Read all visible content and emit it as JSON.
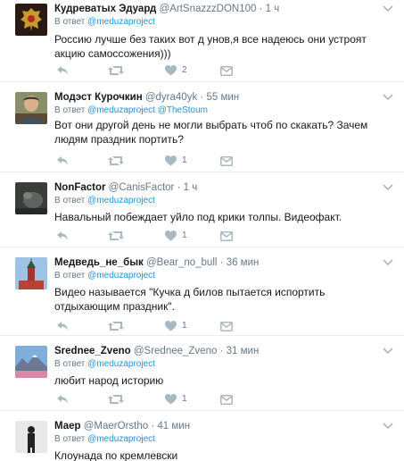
{
  "tweets": [
    {
      "name": "Кудреватых Эдуард",
      "handle": "@ArtSnazzzDON100",
      "separator": "·",
      "time": "1 ч",
      "reply_prefix": "В ответ",
      "mentions": [
        "@meduzaproject"
      ],
      "text": "Россию лучше без таких вот д  унов,я все надеюсь они устроят акцию самоссожения)))",
      "like_count": "2",
      "avatar_icon": "avatar-emblem"
    },
    {
      "name": "Модэст Курочкин",
      "handle": "@dyra40yk",
      "separator": "·",
      "time": "55 мин",
      "reply_prefix": "В ответ",
      "mentions": [
        "@meduzaproject",
        "@TheStoum"
      ],
      "text": "Вот они другой день не могли выбрать чтоб по скакать?  Зачем людям праздник портить?",
      "like_count": "1",
      "avatar_icon": "avatar-person"
    },
    {
      "name": "NonFactor",
      "handle": "@CanisFactor",
      "separator": "·",
      "time": "1 ч",
      "reply_prefix": "В ответ",
      "mentions": [
        "@meduzaproject"
      ],
      "text": "Навальный побеждает  уйло под крики толпы. Видеофакт.",
      "like_count": "1",
      "avatar_icon": "avatar-dark-photo"
    },
    {
      "name": "Медведь_не_бык",
      "handle": "@Bear_no_bull",
      "separator": "·",
      "time": "36 мин",
      "reply_prefix": "В ответ",
      "mentions": [
        "@meduzaproject"
      ],
      "text": "Видео называется \"Кучка д  билов пытается испортить отдыхающим праздник\".",
      "like_count": "1",
      "avatar_icon": "avatar-kremlin-tower"
    },
    {
      "name": "Srednee_Zveno",
      "handle": "@Srednee_Zveno",
      "separator": "·",
      "time": "31 мин",
      "reply_prefix": "В ответ",
      "mentions": [
        "@meduzaproject"
      ],
      "text": "любит народ историю",
      "like_count": "1",
      "avatar_icon": "avatar-landscape"
    },
    {
      "name": "Маер",
      "handle": "@MaerOrstho",
      "separator": "·",
      "time": "41 мин",
      "reply_prefix": "В ответ",
      "mentions": [
        "@meduzaproject"
      ],
      "text": "Клоунада по кремлевски",
      "like_count": "",
      "avatar_icon": "avatar-figure"
    }
  ],
  "colors": {
    "link": "#1b95e0",
    "muted": "#657786",
    "text": "#14171a",
    "divider": "#e6ecf0",
    "icon": "#aab8c2"
  }
}
